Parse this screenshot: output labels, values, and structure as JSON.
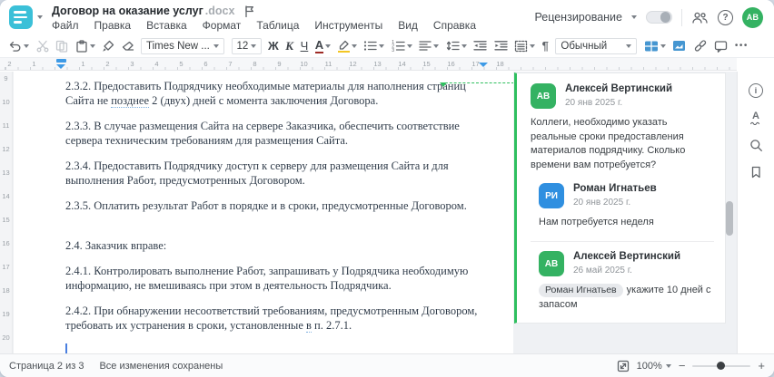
{
  "header": {
    "title": "Договор на оказание услуг",
    "title_ext": ".docx",
    "menu": [
      "Файл",
      "Правка",
      "Вставка",
      "Формат",
      "Таблица",
      "Инструменты",
      "Вид",
      "Справка"
    ],
    "review_label": "Рецензирование",
    "help_glyph": "?",
    "avatar_initials": "АВ"
  },
  "toolbar": {
    "font_name": "Times New ...",
    "font_size": "12",
    "bold": "Ж",
    "italic": "К",
    "underline": "Ч",
    "font_color_letter": "А",
    "style_name": "Обычный",
    "pilcrow": "¶",
    "more": "•••",
    "num1": "1",
    "num2": "2",
    "num3": "3"
  },
  "ruler": {
    "h_numbers": [
      "2",
      "1",
      "",
      "1",
      "2",
      "3",
      "4",
      "5",
      "6",
      "7",
      "8",
      "9",
      "10",
      "11",
      "12",
      "13",
      "14",
      "15",
      "16",
      "17",
      "18"
    ],
    "v_numbers": [
      "9",
      "10",
      "11",
      "12",
      "13",
      "14",
      "15",
      "16",
      "17",
      "18",
      "19",
      "20"
    ]
  },
  "document": {
    "p1a": "2.3.2. Предоставить Подрядчику необходимые материалы для наполнения страниц Сайта не ",
    "p1_anchor": "позднее",
    "p1b": " 2 (двух) дней с момента заключения Договора.",
    "p2": "2.3.3. В случае размещения Сайта на сервере Заказчика, обеспечить соответствие сервера техническим требованиям для размещения Сайта.",
    "p3": "2.3.4. Предоставить Подрядчику доступ к серверу для размещения Сайта и для выполнения Работ, предусмотренных Договором.",
    "p4": "2.3.5. Оплатить результат Работ в порядке и в сроки, предусмотренные Договором.",
    "p5": "2.4. Заказчик вправе:",
    "p6": "2.4.1. Контролировать выполнение Работ, запрашивать у Подрядчика необходимую информацию, не вмешиваясь при этом в деятельность Подрядчика.",
    "p7a": "2.4.2. При обнаружении несоответствий требованиям, предусмотренным Договором, требовать их устранения в сроки, установленные ",
    "p7_anchor": "в",
    "p7b": " п. 2.7.1."
  },
  "comments": {
    "list": [
      {
        "initials": "АВ",
        "name": "Алексей Вертинский",
        "date": "20 янв 2025 г.",
        "text": "Коллеги, необходимо указать реальные сроки предоставления материалов подрядчику. Сколько времени вам потребуется?"
      },
      {
        "initials": "РИ",
        "name": "Роман Игнатьев",
        "date": "20 янв 2025 г.",
        "text": "Нам потребуется неделя"
      },
      {
        "initials": "АВ",
        "name": "Алексей Вертинский",
        "date": "26 май 2025 г.",
        "mention": "Роман Игнатьев",
        "text": "укажите 10 дней с запасом"
      }
    ]
  },
  "sidebar_icons": {
    "info": "i",
    "spell_letter": "А"
  },
  "statusbar": {
    "page_info": "Страница 2 из 3",
    "saved_info": "Все изменения сохранены",
    "zoom": "100%",
    "minus": "−",
    "plus": "+"
  },
  "colors": {
    "logo_teal": "#3bc0d8",
    "avatar_green": "#34b262",
    "avatar_blue": "#2f8fe0",
    "comment_green": "#2fbf5f",
    "toolbar_blue": "#4596d1",
    "marker_blue": "#3e9ae6"
  }
}
